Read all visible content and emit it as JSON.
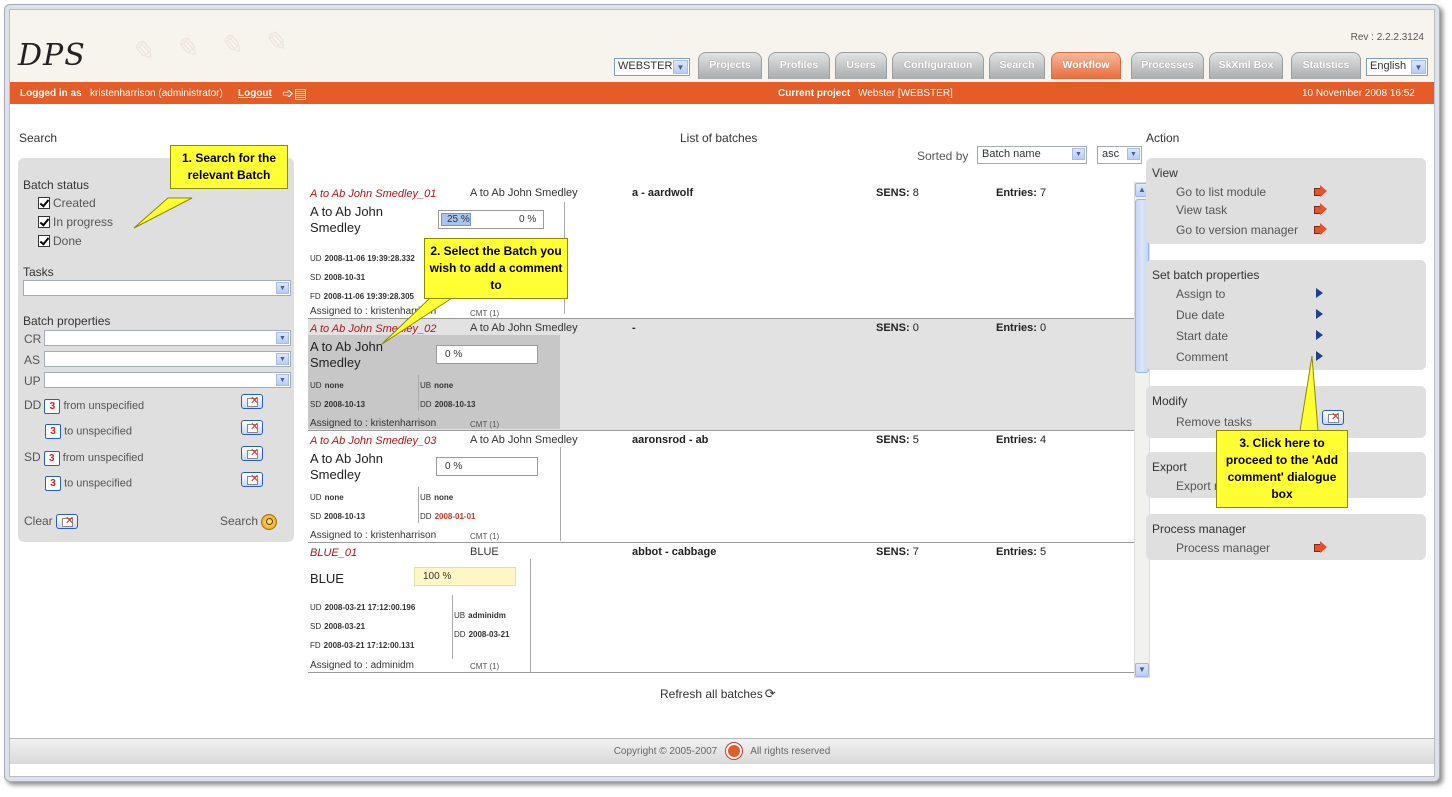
{
  "app": {
    "logo": "DPS",
    "rev": "Rev : 2.2.2.3124"
  },
  "project_select": {
    "value": "WEBSTER"
  },
  "nav": {
    "tabs": [
      "Projects",
      "Profiles",
      "Users",
      "Configuration",
      "Search",
      "Workflow",
      "Processes",
      "SkXml Box",
      "Statistics"
    ],
    "active": "Workflow"
  },
  "language": {
    "value": "English"
  },
  "status_bar": {
    "logged_label": "Logged in as",
    "user": "kristenharrison (administrator)",
    "logout": "Logout",
    "current_project_label": "Current project",
    "current_project": "Webster [WEBSTER]",
    "datetime": "10 November 2008 16:52"
  },
  "search_panel": {
    "title": "Search",
    "batch_status_label": "Batch status",
    "statuses": [
      "Created",
      "In progress",
      "Done"
    ],
    "tasks_label": "Tasks",
    "batch_properties_label": "Batch properties",
    "props": [
      "CR",
      "AS",
      "UP"
    ],
    "dd_label": "DD",
    "sd_label": "SD",
    "cal_num": "3",
    "from_unspecified": "from unspecified",
    "to_unspecified": "to unspecified",
    "clear": "Clear",
    "search": "Search"
  },
  "list": {
    "title": "List of batches",
    "sorted_by_label": "Sorted by",
    "sort_field": "Batch name",
    "sort_order": "asc",
    "refresh": "Refresh all batches",
    "batches": [
      {
        "name": "A to Ab John Smedley_01",
        "sub": "A to Ab John Smedley",
        "range": "a - aardwolf",
        "sens_label": "SENS:",
        "sens": "8",
        "entries_label": "Entries:",
        "entries": "7",
        "title": "A to Ab John Smedley",
        "progress": "25 %",
        "progress2": "0 %",
        "ud_label": "UD",
        "ud": "2008-11-06 19:39:28.332",
        "sd_label": "SD",
        "sd": "2008-10-31",
        "fd_label": "FD",
        "fd": "2008-11-06 19:39:28.305",
        "assigned": "Assigned to : kristenharrison",
        "cmt": "CMT (1)"
      },
      {
        "name": "A to Ab John Smedley_02",
        "sub": "A to Ab John Smedley",
        "range": "-",
        "sens_label": "SENS:",
        "sens": "0",
        "entries_label": "Entries:",
        "entries": "0",
        "title": "A to Ab John Smedley",
        "progress": "0 %",
        "ud_label": "UD",
        "ud": "none",
        "ub_label": "UB",
        "ub": "none",
        "sd_label": "SD",
        "sd": "2008-10-13",
        "dd_label": "DD",
        "dd": "2008-10-13",
        "assigned": "Assigned to : kristenharrison",
        "cmt": "CMT (1)"
      },
      {
        "name": "A to Ab John Smedley_03",
        "sub": "A to Ab John Smedley",
        "range": "aaronsrod - ab",
        "sens_label": "SENS:",
        "sens": "5",
        "entries_label": "Entries:",
        "entries": "4",
        "title": "A to Ab John Smedley",
        "progress": "0 %",
        "ud_label": "UD",
        "ud": "none",
        "ub_label": "UB",
        "ub": "none",
        "sd_label": "SD",
        "sd": "2008-10-13",
        "dd_label": "DD",
        "dd": "2008-01-01",
        "assigned": "Assigned to : kristenharrison",
        "cmt": "CMT (1)"
      },
      {
        "name": "BLUE_01",
        "sub": "BLUE",
        "range": "abbot - cabbage",
        "sens_label": "SENS:",
        "sens": "7",
        "entries_label": "Entries:",
        "entries": "5",
        "title": "BLUE",
        "progress": "100 %",
        "ud_label": "UD",
        "ud": "2008-03-21 17:12:00.196",
        "sd_label": "SD",
        "sd": "2008-03-21",
        "fd_label": "FD",
        "fd": "2008-03-21 17:12:00.131",
        "ub_label": "UB",
        "ub": "adminidm",
        "dd_label": "DD",
        "dd": "2008-03-21",
        "assigned": "Assigned to : adminidm",
        "cmt": "CMT (1)"
      }
    ]
  },
  "action_panel": {
    "title": "Action",
    "groups": [
      {
        "title": "View",
        "items": [
          "Go to list module",
          "View task",
          "Go to version manager"
        ]
      },
      {
        "title": "Set batch properties",
        "items": [
          "Assign to",
          "Due date",
          "Start date",
          "Comment"
        ]
      },
      {
        "title": "Modify",
        "items": [
          "Remove tasks"
        ]
      },
      {
        "title": "Export",
        "items": [
          "Export r"
        ]
      },
      {
        "title": "Process manager",
        "items": [
          "Process manager"
        ]
      }
    ]
  },
  "callouts": [
    "1. Search for the relevant Batch",
    "2. Select the Batch you wish to add a comment to",
    "3. Click here to proceed to the 'Add comment' dialogue box"
  ],
  "footer": {
    "copyright": "Copyright © 2005-2007",
    "rights": "All rights reserved"
  },
  "colors": {
    "accent": "#e55c27",
    "batch_name": "#aa1717",
    "callout": "#ffff33",
    "panel": "#dfdfdf"
  }
}
